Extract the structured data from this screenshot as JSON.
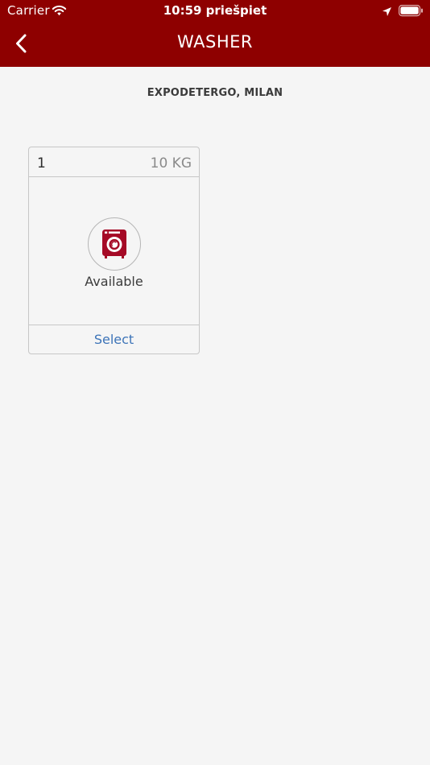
{
  "status_bar": {
    "carrier": "Carrier",
    "time": "10:59 priešpiet"
  },
  "header": {
    "title": "WASHER",
    "background": "#8e0000"
  },
  "location": {
    "label": "EXPODETERGO, MILAN"
  },
  "machines": [
    {
      "number": "1",
      "capacity": "10 KG",
      "status": "Available",
      "action": "Select",
      "icon": "washer-icon"
    }
  ],
  "colors": {
    "accent": "#8e0000",
    "link": "#3d74b8"
  }
}
